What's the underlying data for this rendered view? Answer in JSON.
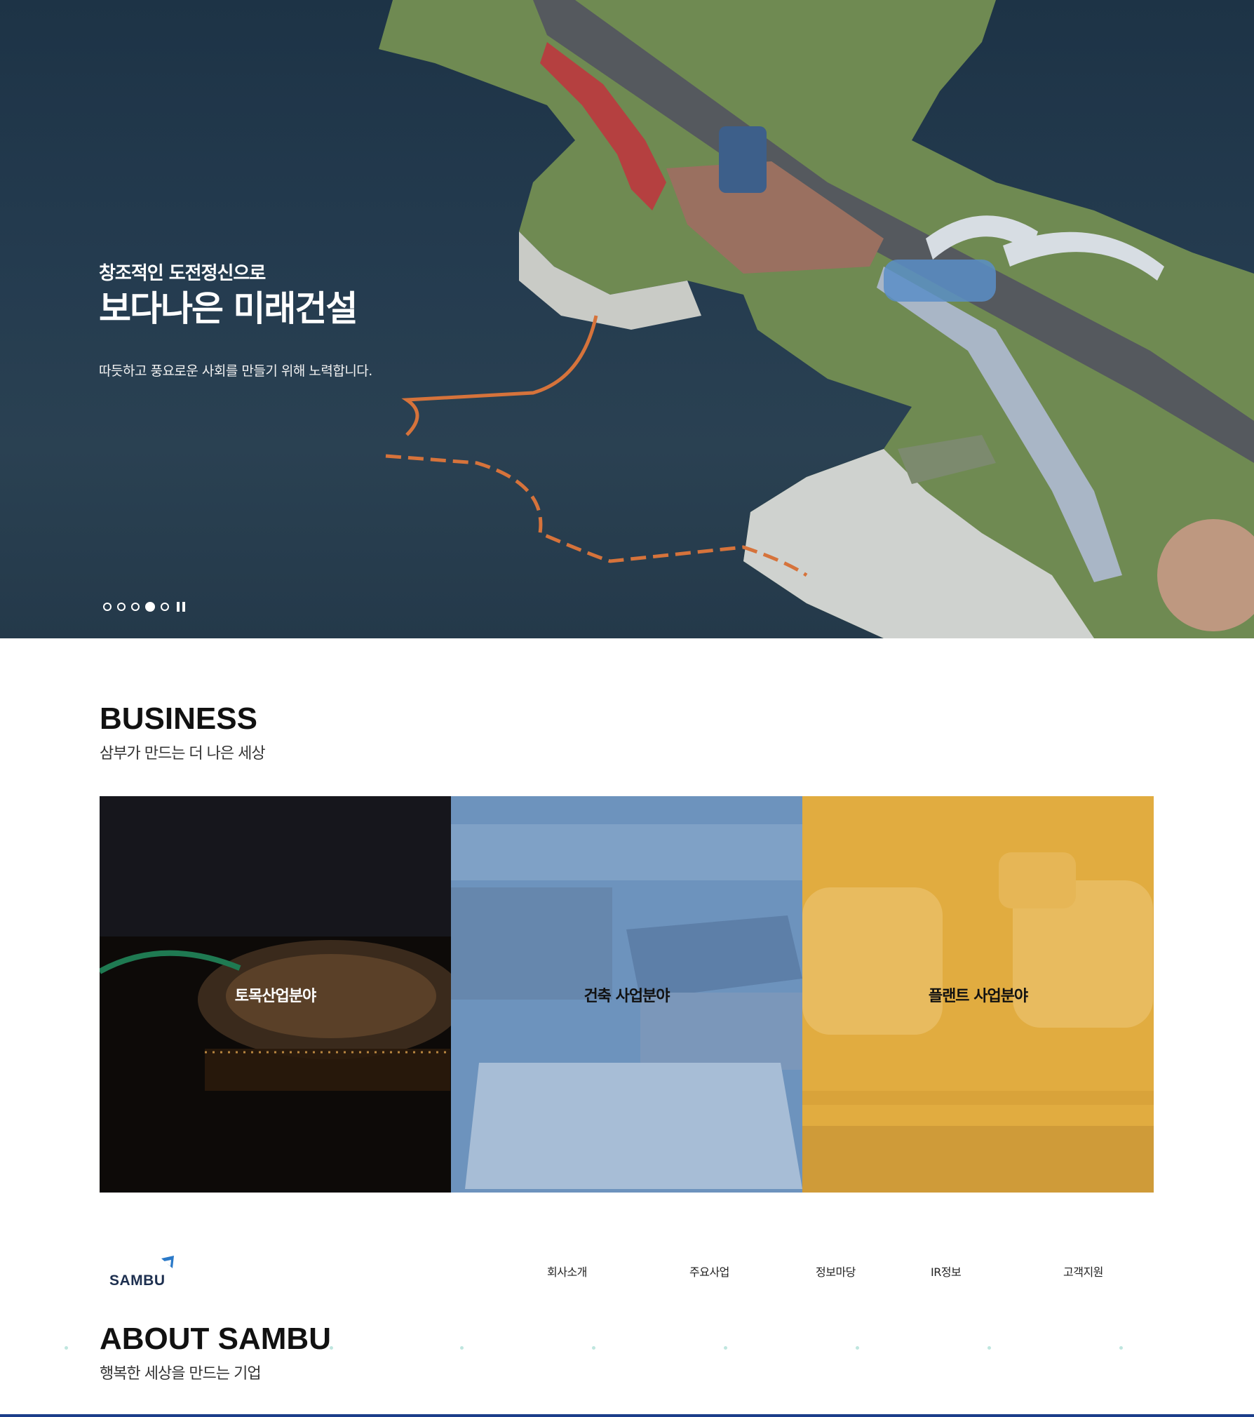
{
  "hero": {
    "kicker": "창조적인 도전정신으로",
    "title": "보다나은 미래건설",
    "description": "따듯하고 풍요로운 사회를 만들기 위해 노력합니다.",
    "slider": {
      "total_slides": 5,
      "active_slide": 4,
      "pause_icon": "pause-icon"
    }
  },
  "business": {
    "title": "BUSINESS",
    "subtitle": "삼부가 만드는 더 나은 세상",
    "cards": [
      {
        "label": "토목산업분야",
        "tint": "#0d0a08"
      },
      {
        "label": "건축 사업분야",
        "tint": "#6d93bd"
      },
      {
        "label": "플랜트 사업분야",
        "tint": "#e1ac40"
      }
    ]
  },
  "brand": {
    "logo_text": "SAMBU",
    "logo_color": "#1d2f4f",
    "mark_color": "#2a79c8"
  },
  "nav": {
    "items": [
      "회사소개",
      "주요사업",
      "정보마당",
      "IR정보",
      "고객지원"
    ]
  },
  "about": {
    "title": "ABOUT SAMBU",
    "subtitle": "행복한 세상을 만드는 기업"
  },
  "colors": {
    "accent_bar": "#1b3d8a",
    "deco_dot": "#bfe6df"
  }
}
